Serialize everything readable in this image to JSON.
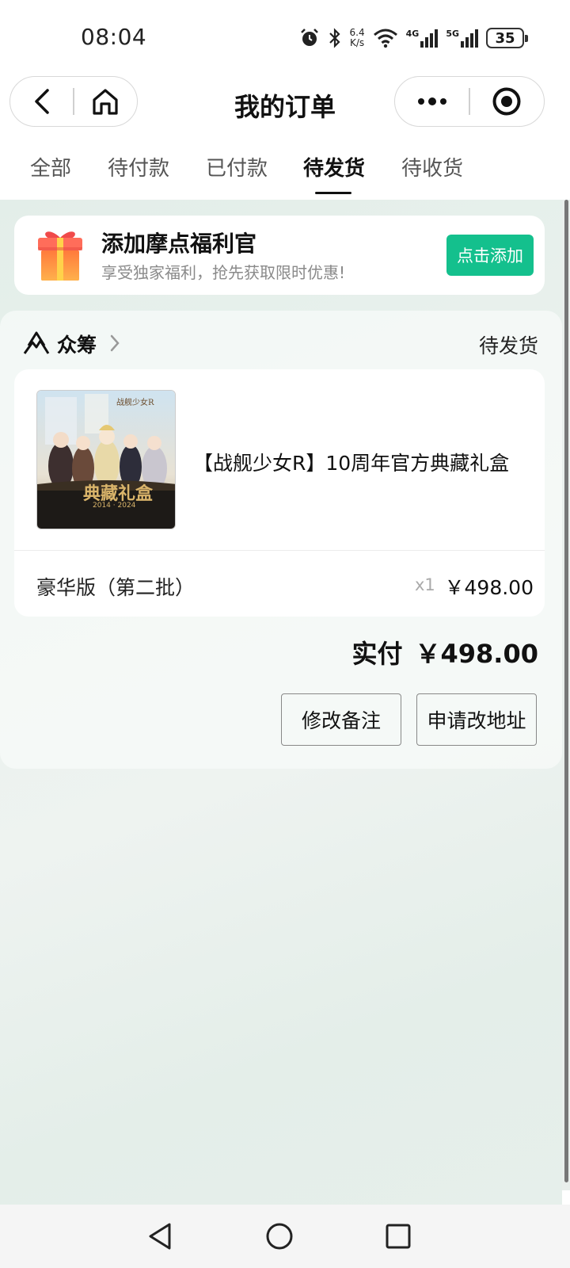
{
  "status_bar": {
    "time": "08:04",
    "net_speed_value": "6.4",
    "net_speed_unit": "K/s",
    "signal_4g": "4G",
    "signal_5g": "5G",
    "battery": "35",
    "icons": [
      "alarm-icon",
      "bluetooth-icon",
      "wifi-icon",
      "signal-4g-icon",
      "signal-5g-icon",
      "battery-icon"
    ]
  },
  "nav": {
    "title": "我的订单",
    "icons": [
      "back-icon",
      "home-icon",
      "more-icon",
      "target-icon"
    ]
  },
  "tabs": [
    {
      "label": "全部",
      "active": false
    },
    {
      "label": "待付款",
      "active": false
    },
    {
      "label": "已付款",
      "active": false
    },
    {
      "label": "待发货",
      "active": true
    },
    {
      "label": "待收货",
      "active": false
    }
  ],
  "promo": {
    "title": "添加摩点福利官",
    "subtitle": "享受独家福利，抢先获取限时优惠!",
    "button": "点击添加",
    "button_color": "#14c08d",
    "icon": "gift-box-icon"
  },
  "order": {
    "source": "众筹",
    "status": "待发货",
    "product_title": "【战舰少女R】10周年官方典藏礼盒",
    "product_image": {
      "logo_text": "战舰少女R",
      "banner_text": "典藏礼盒",
      "years": "2014 · 2024"
    },
    "variant": "豪华版（第二批）",
    "quantity": "x1",
    "unit_price": "￥498.00",
    "paid_label": "实付",
    "paid_amount": "￥498.00",
    "actions": {
      "edit_note": "修改备注",
      "change_address": "申请改地址"
    }
  },
  "system_nav": {
    "icons": [
      "back-triangle-icon",
      "home-circle-icon",
      "recents-square-icon"
    ]
  }
}
